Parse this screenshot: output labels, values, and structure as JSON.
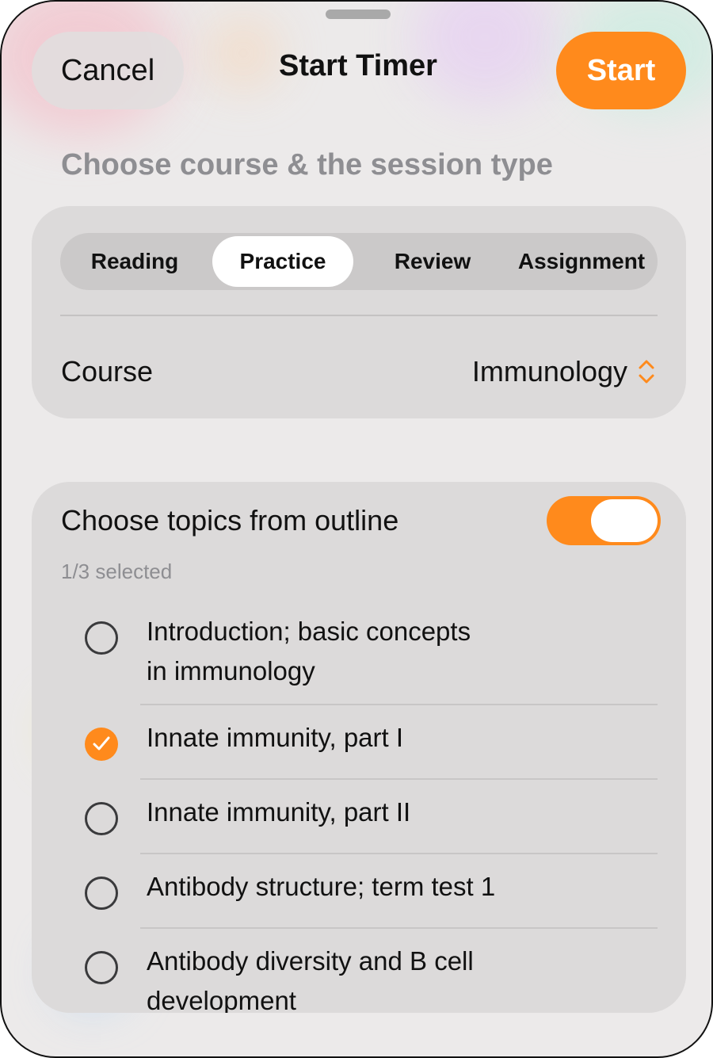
{
  "header": {
    "cancel_label": "Cancel",
    "title": "Start Timer",
    "start_label": "Start"
  },
  "section_title": "Choose course & the session type",
  "session_types": [
    {
      "label": "Reading",
      "selected": false
    },
    {
      "label": "Practice",
      "selected": true
    },
    {
      "label": "Review",
      "selected": false
    },
    {
      "label": "Assignment",
      "selected": false
    }
  ],
  "course": {
    "label": "Course",
    "value": "Immunology",
    "icon": "chevron-up-down-icon"
  },
  "topics": {
    "toggle_label": "Choose topics from outline",
    "toggle_on": true,
    "selected_count": "1/3 selected",
    "items": [
      {
        "line1": "Introduction; basic concepts",
        "line2": "in immunology",
        "checked": false
      },
      {
        "line1": "Innate immunity, part I",
        "line2": "",
        "checked": true
      },
      {
        "line1": "Innate immunity, part II",
        "line2": "",
        "checked": false
      },
      {
        "line1": "Antibody structure; term test 1",
        "line2": "",
        "checked": false
      },
      {
        "line1": "Antibody diversity and B cell",
        "line2": "development",
        "checked": false
      }
    ]
  },
  "colors": {
    "accent": "#ff8a1c",
    "secondary_text": "#8e8e92",
    "card_bg": "#dcdada"
  }
}
